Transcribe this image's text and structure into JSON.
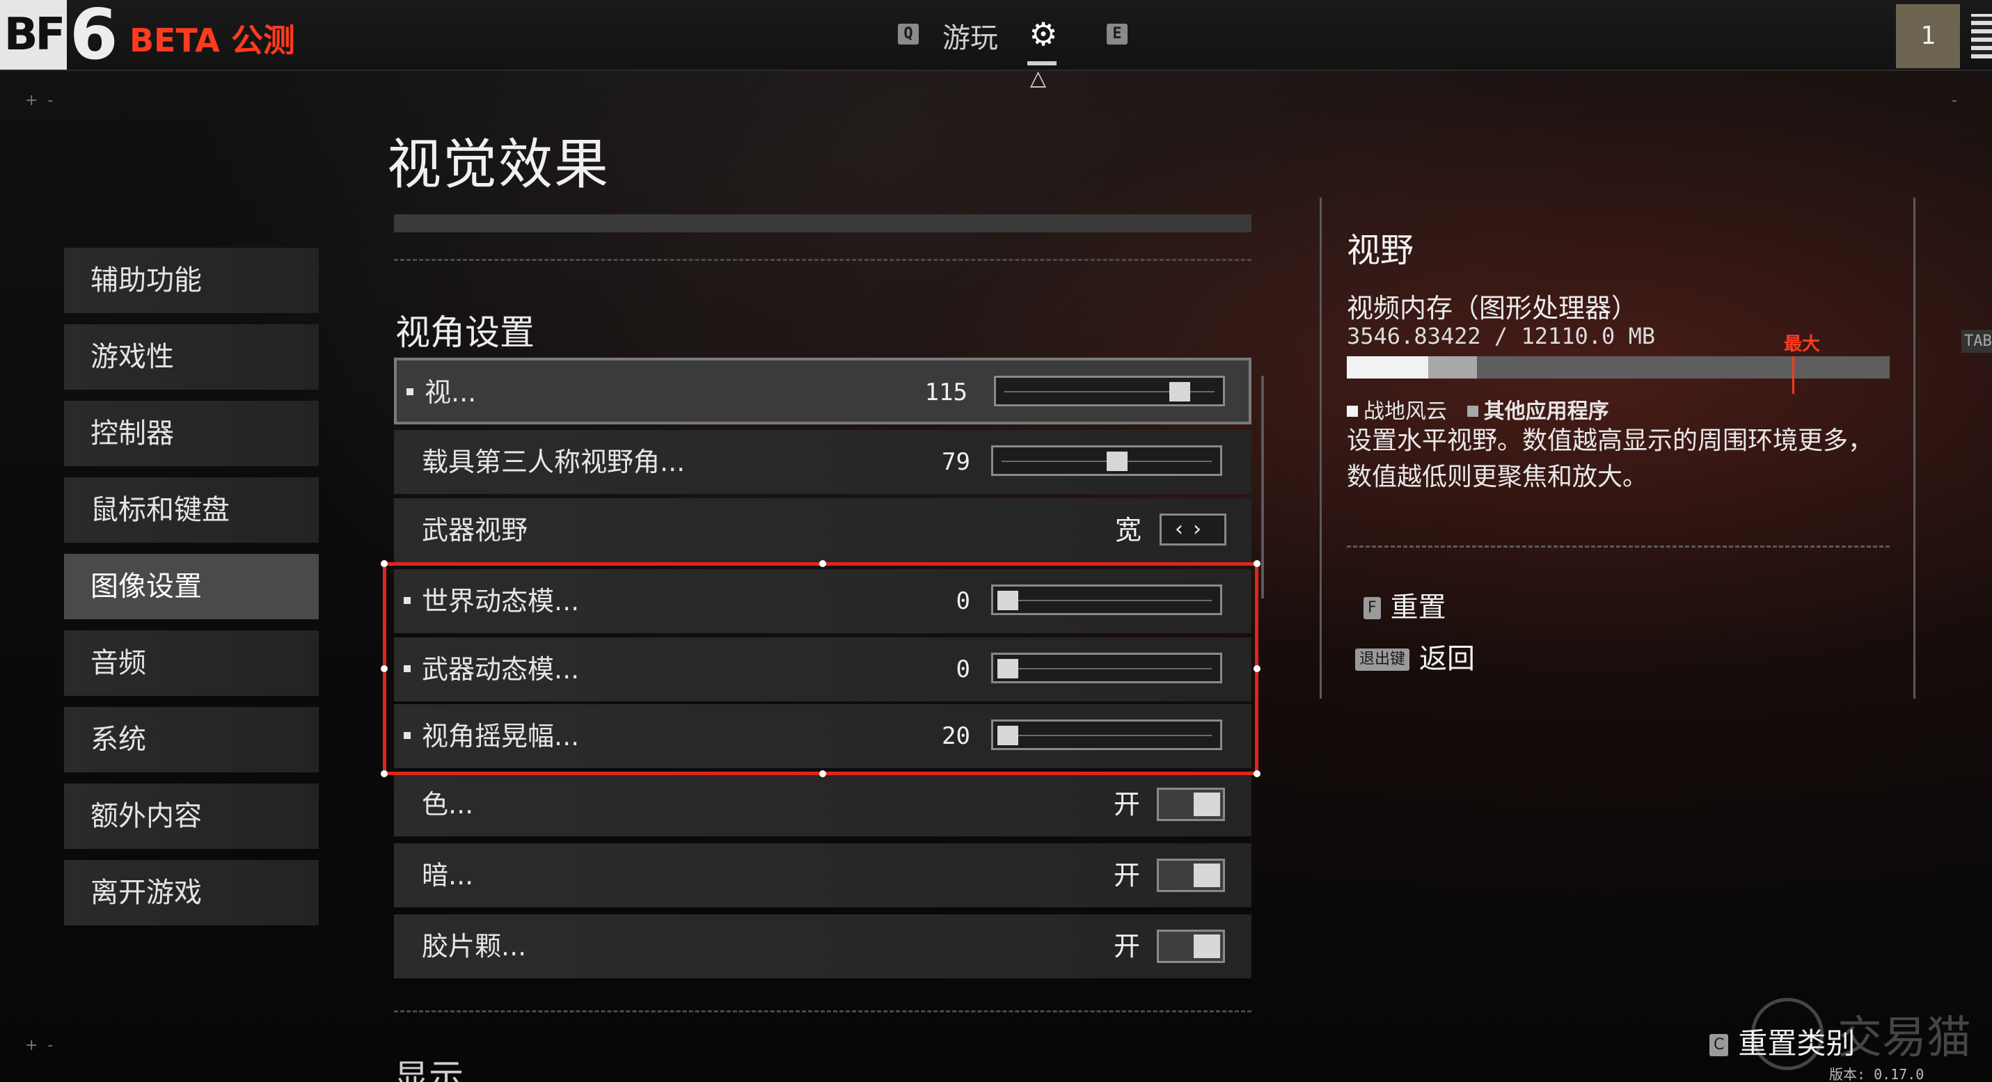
{
  "header": {
    "logo_bf": "BF",
    "logo_num": "6",
    "beta_label": "BETA 公测",
    "nav_left_key": "Q",
    "nav_play": "游玩",
    "nav_right_key": "E",
    "player_count": "1"
  },
  "page_title": "视觉效果",
  "sidebar": {
    "items": [
      {
        "label": "辅助功能"
      },
      {
        "label": "游戏性"
      },
      {
        "label": "控制器"
      },
      {
        "label": "鼠标和键盘"
      },
      {
        "label": "图像设置",
        "active": true
      },
      {
        "label": "音频"
      },
      {
        "label": "系统"
      },
      {
        "label": "额外内容"
      },
      {
        "label": "离开游戏"
      }
    ]
  },
  "settings": {
    "section_title": "视角设置",
    "rows": [
      {
        "label": "视...",
        "value": "115",
        "type": "slider",
        "fraction": 0.85,
        "selected": true
      },
      {
        "label": "载具第三人称视野角...",
        "value": "79",
        "type": "slider",
        "fraction": 0.55
      },
      {
        "label": "武器视野",
        "value": "宽",
        "type": "selector"
      },
      {
        "label": "世界动态模...",
        "value": "0",
        "type": "slider",
        "fraction": 0.0
      },
      {
        "label": "武器动态模...",
        "value": "0",
        "type": "slider",
        "fraction": 0.0
      },
      {
        "label": "视角摇晃幅...",
        "value": "20",
        "type": "slider",
        "fraction": 0.0
      },
      {
        "label": "色...",
        "value": "开",
        "type": "toggle"
      },
      {
        "label": "暗...",
        "value": "开",
        "type": "toggle"
      },
      {
        "label": "胶片颗...",
        "value": "开",
        "type": "toggle"
      }
    ],
    "next_section_partial": "显示"
  },
  "info": {
    "title": "视野",
    "vram_label": "视频内存（图形处理器）",
    "vram_value": "3546.83422 / 12110.0 MB",
    "max_label": "最大",
    "vram_bf_fraction": 0.15,
    "vram_other_fraction": 0.09,
    "vram_max_fraction": 0.82,
    "legend_bf": "战地风云",
    "legend_other": "其他应用程序",
    "description": "设置水平视野。数值越高显示的周围环境更多，数值越低则更聚焦和放大。",
    "reset_key": "F",
    "reset_label": "重置",
    "back_key": "退出键",
    "back_label": "返回"
  },
  "footer": {
    "reset_category_key": "C",
    "reset_category_label": "重置类别",
    "version": "版本: 0.17.0",
    "side_tab": "TAB",
    "watermark": "交易猫"
  },
  "colors": {
    "accent_red": "#e0261a",
    "beta_red": "#ff3b1f"
  }
}
